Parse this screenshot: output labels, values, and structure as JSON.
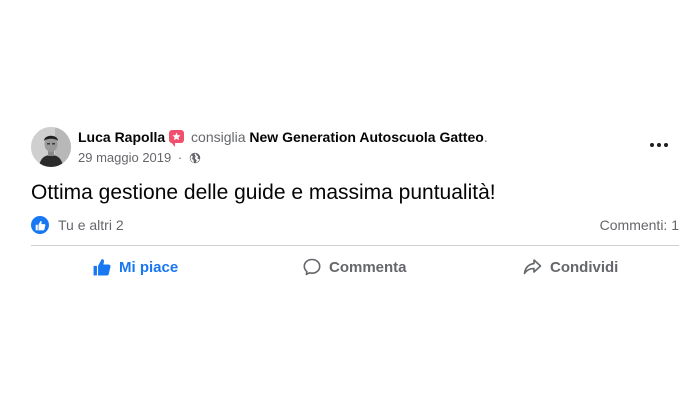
{
  "post": {
    "author": "Luca Rapolla",
    "verb": "consiglia",
    "page_name": "New Generation Autoscuola Gatteo",
    "page_suffix": ".",
    "date": "29 maggio 2019",
    "separator": "·",
    "audience_icon": "globe-icon",
    "badge_icon": "recommendation-star-icon",
    "text": "Ottima gestione delle guide e massima puntualità!",
    "reactions_icon": "like-icon",
    "reactions_text": "Tu e altri 2",
    "comments_text": "Commenti: 1",
    "menu_icon": "more-horizontal-icon"
  },
  "actions": {
    "like_label": "Mi piace",
    "comment_label": "Commenta",
    "share_label": "Condividi"
  },
  "colors": {
    "accent": "#1877f2",
    "badge": "#f0506e",
    "secondary_text": "#65676b",
    "primary_text": "#050505",
    "divider": "#ced0d4"
  }
}
